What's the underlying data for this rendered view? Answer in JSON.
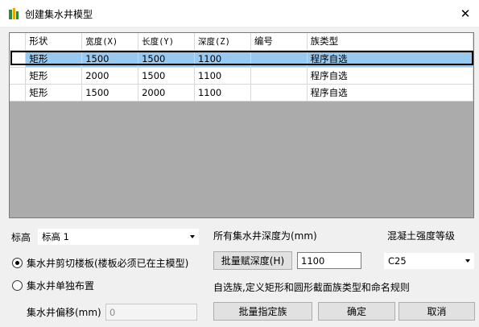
{
  "window": {
    "title": "创建集水井模型",
    "close_glyph": "✕"
  },
  "grid": {
    "columns": [
      "形状",
      "宽度(X)",
      "长度(Y)",
      "深度(Z)",
      "编号",
      "族类型"
    ],
    "rows": [
      {
        "shape": "矩形",
        "width": "1500",
        "length": "1500",
        "depth": "1100",
        "code": "",
        "family": "程序自选",
        "selected": true
      },
      {
        "shape": "矩形",
        "width": "2000",
        "length": "1500",
        "depth": "1100",
        "code": "",
        "family": "程序自选",
        "selected": false
      },
      {
        "shape": "矩形",
        "width": "1500",
        "length": "2000",
        "depth": "1100",
        "code": "",
        "family": "程序自选",
        "selected": false
      }
    ]
  },
  "level": {
    "label": "标高",
    "value": "标高 1"
  },
  "depth_all": {
    "label": "所有集水井深度为(mm)",
    "button": "批量赋深度(H)",
    "value": "1100"
  },
  "concrete": {
    "label": "混凝土强度等级",
    "value": "C25"
  },
  "options": {
    "cut_slab": {
      "label": "集水井剪切楼板(楼板必须已在主模型)",
      "checked": true
    },
    "standalone": {
      "label": "集水井单独布置",
      "checked": false
    }
  },
  "offset": {
    "label": "集水井偏移(mm)",
    "value": "0"
  },
  "hint": "自选族,定义矩形和圆形截面族类型和命名规则",
  "buttons": {
    "assign_family": "批量指定族",
    "ok": "确定",
    "cancel": "取消"
  },
  "colors": {
    "selection": "#99c9ef",
    "grid_bg": "#ababab"
  }
}
